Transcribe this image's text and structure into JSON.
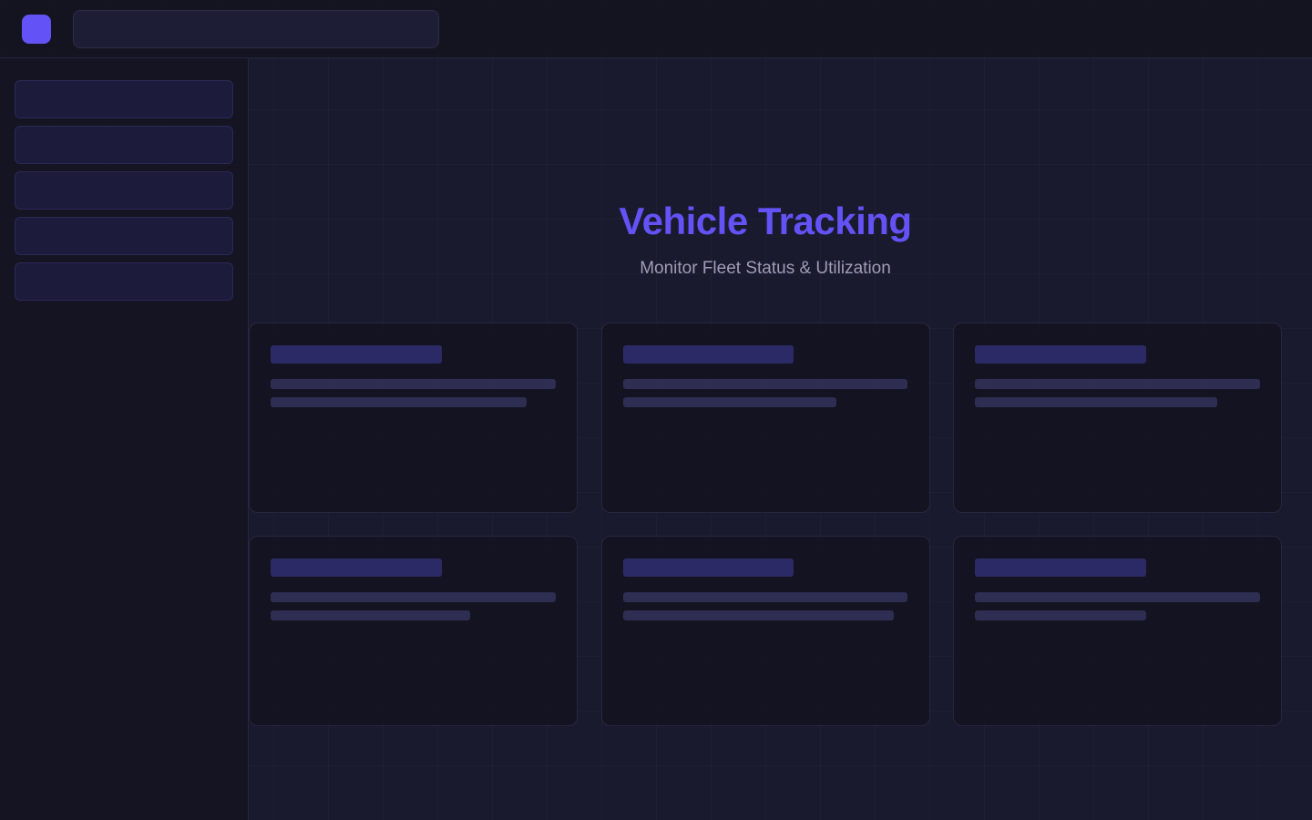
{
  "app": {
    "accent_color": "#6352f5",
    "logo_icon": "app-logo-icon"
  },
  "search": {
    "placeholder": ""
  },
  "sidebar": {
    "items": [
      {
        "label": ""
      },
      {
        "label": ""
      },
      {
        "label": ""
      },
      {
        "label": ""
      },
      {
        "label": ""
      }
    ]
  },
  "hero": {
    "title": "Vehicle Tracking",
    "subtitle": "Monitor Fleet Status & Utilization"
  },
  "cards": [
    {
      "title": "",
      "lines": [
        "",
        ""
      ]
    },
    {
      "title": "",
      "lines": [
        "",
        ""
      ]
    },
    {
      "title": "",
      "lines": [
        "",
        ""
      ]
    },
    {
      "title": "",
      "lines": [
        "",
        ""
      ]
    },
    {
      "title": "",
      "lines": [
        "",
        ""
      ]
    },
    {
      "title": "",
      "lines": [
        "",
        ""
      ]
    }
  ]
}
